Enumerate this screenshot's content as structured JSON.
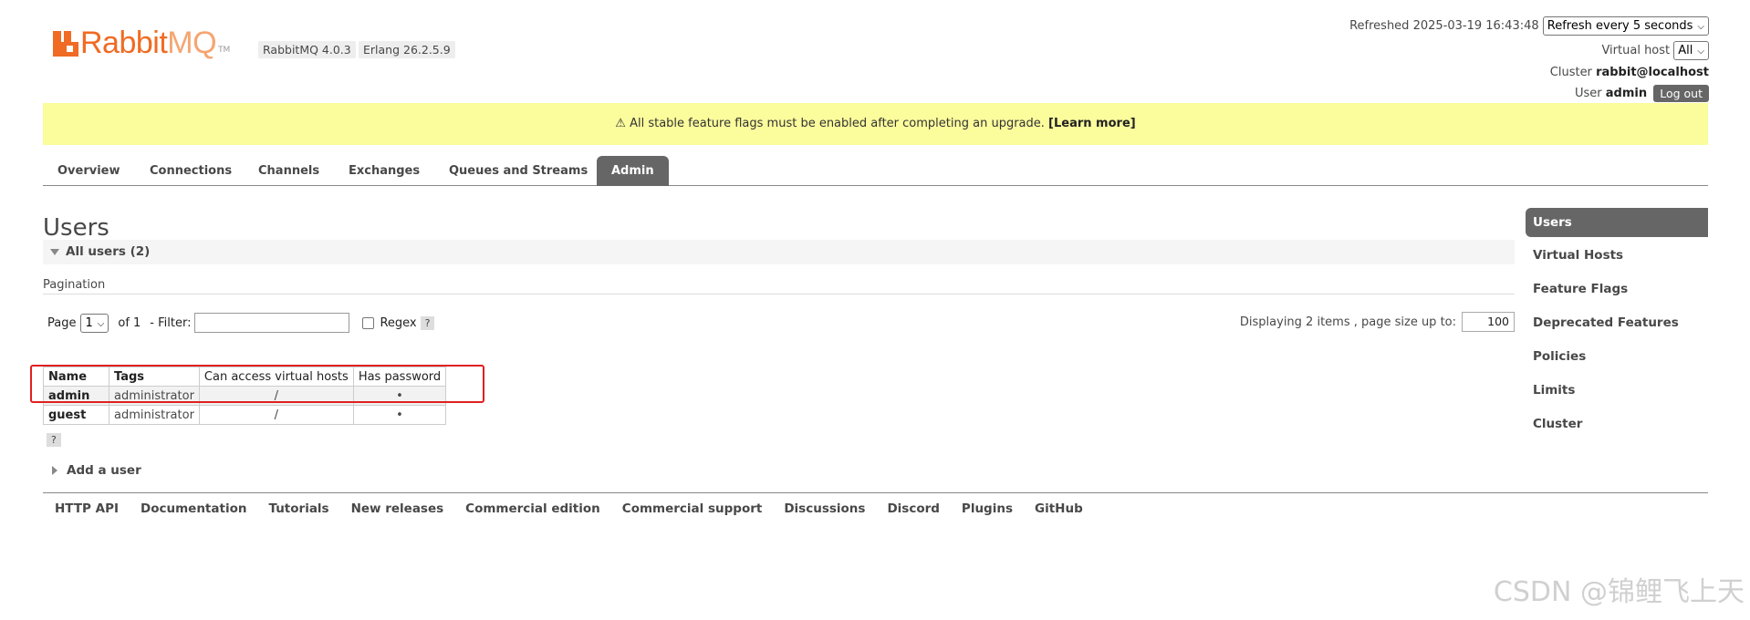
{
  "header": {
    "logo_text_main": "Rabbit",
    "logo_text_light": "MQ",
    "logo_tm": "TM",
    "rabbitmq_version": "RabbitMQ 4.0.3",
    "erlang_version": "Erlang 26.2.5.9",
    "refreshed_label": "Refreshed 2025-03-19 16:43:48",
    "refresh_select": "Refresh every 5 seconds",
    "vhost_label": "Virtual host",
    "vhost_select": "All",
    "cluster_label": "Cluster",
    "cluster_name": "rabbit@localhost",
    "user_label": "User",
    "user_name": "admin",
    "logout_label": "Log out"
  },
  "banner": {
    "icon": "⚠",
    "text": "All stable feature flags must be enabled after completing an upgrade.",
    "link": "[Learn more]",
    "color": "#fbfc9c"
  },
  "tabs": [
    {
      "label": "Overview"
    },
    {
      "label": "Connections"
    },
    {
      "label": "Channels"
    },
    {
      "label": "Exchanges"
    },
    {
      "label": "Queues and Streams"
    },
    {
      "label": "Admin",
      "active": true
    }
  ],
  "main": {
    "title": "Users",
    "section_title": "All users (2)",
    "pagination_label": "Pagination",
    "page_label": "Page",
    "page_select": "1",
    "of_label": "of 1",
    "filter_label": "- Filter:",
    "filter_value": "",
    "regex_label": "Regex",
    "regex_checked": false,
    "help_label": "?",
    "display_info": "Displaying 2 items , page size up to:",
    "page_size": "100",
    "add_user_label": "Add a user"
  },
  "users_table": {
    "columns": [
      "Name",
      "Tags",
      "Can access virtual hosts",
      "Has password"
    ],
    "rows": [
      {
        "name": "admin",
        "tags": "administrator",
        "vhosts": "/",
        "has_password": "•"
      },
      {
        "name": "guest",
        "tags": "administrator",
        "vhosts": "/",
        "has_password": "•"
      }
    ]
  },
  "sidebar": {
    "items": [
      {
        "label": "Users",
        "active": true
      },
      {
        "label": "Virtual Hosts"
      },
      {
        "label": "Feature Flags"
      },
      {
        "label": "Deprecated Features"
      },
      {
        "label": "Policies"
      },
      {
        "label": "Limits"
      },
      {
        "label": "Cluster"
      }
    ]
  },
  "footer": {
    "links": [
      "HTTP API",
      "Documentation",
      "Tutorials",
      "New releases",
      "Commercial edition",
      "Commercial support",
      "Discussions",
      "Discord",
      "Plugins",
      "GitHub"
    ]
  },
  "watermark": "CSDN @锦鲤飞上天",
  "colors": {
    "brand": "#f06b23",
    "active_tab": "#666666",
    "highlight_box": "#e02020"
  }
}
